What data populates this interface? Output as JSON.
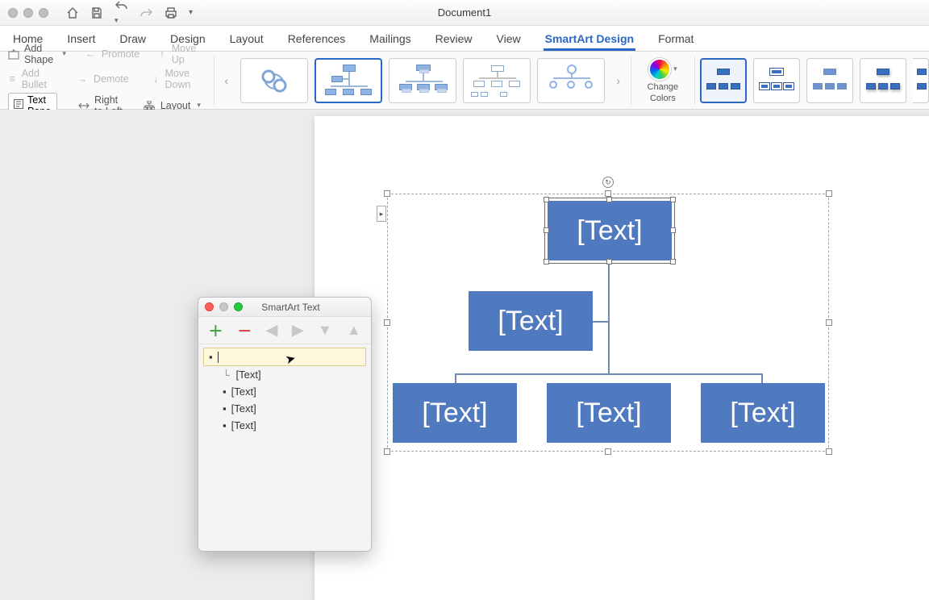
{
  "titlebar": {
    "document_title": "Document1"
  },
  "tabs": {
    "items": [
      "Home",
      "Insert",
      "Draw",
      "Design",
      "Layout",
      "References",
      "Mailings",
      "Review",
      "View",
      "SmartArt Design",
      "Format"
    ],
    "active_index": 9
  },
  "ribbon": {
    "add_shape": "Add Shape",
    "add_bullet": "Add Bullet",
    "text_pane": "Text Pane",
    "promote": "Promote",
    "demote": "Demote",
    "right_to_left": "Right to Left",
    "move_up": "Move Up",
    "move_down": "Move Down",
    "layout": "Layout",
    "change_colors_line1": "Change",
    "change_colors_line2": "Colors"
  },
  "text_pane": {
    "title": "SmartArt Text",
    "items": [
      {
        "level": 0,
        "text": "",
        "editing": true
      },
      {
        "level": 1,
        "text": "[Text]",
        "assistant": true
      },
      {
        "level": 1,
        "text": "[Text]"
      },
      {
        "level": 1,
        "text": "[Text]"
      },
      {
        "level": 1,
        "text": "[Text]"
      }
    ]
  },
  "smartart": {
    "nodes": {
      "top": "[Text]",
      "assistant": "[Text]",
      "child1": "[Text]",
      "child2": "[Text]",
      "child3": "[Text]"
    }
  }
}
